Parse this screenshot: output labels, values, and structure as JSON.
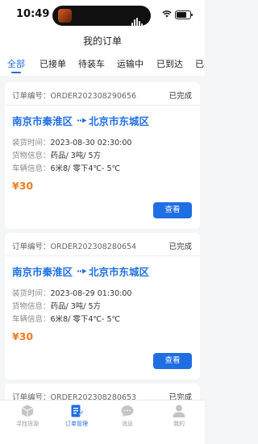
{
  "status_bar": {
    "time": "10:49"
  },
  "header": {
    "title": "我的订单"
  },
  "tabs": [
    {
      "label": "全部",
      "active": true
    },
    {
      "label": "已接单",
      "active": false
    },
    {
      "label": "待装车",
      "active": false
    },
    {
      "label": "运输中",
      "active": false
    },
    {
      "label": "已到达",
      "active": false
    },
    {
      "label": "已完成",
      "active": false
    }
  ],
  "orders": [
    {
      "order_label": "订单编号：",
      "order_no": "ORDER202308290656",
      "status": "已完成",
      "from_city": "南京市秦淮区",
      "to_city": "北京市东城区",
      "load_time_label": "装货时间：",
      "load_time": "2023-08-30 02:30:00",
      "cargo_label": "货物信息：",
      "cargo": "药品/ 3吨/ 5方",
      "vehicle_label": "车辆信息：",
      "vehicle": "6米8/ 零下4℃- 5℃",
      "price": "¥30",
      "action": "查看"
    },
    {
      "order_label": "订单编号：",
      "order_no": "ORDER202308280654",
      "status": "已完成",
      "from_city": "南京市秦淮区",
      "to_city": "北京市东城区",
      "load_time_label": "装货时间：",
      "load_time": "2023-08-29 01:30:00",
      "cargo_label": "货物信息：",
      "cargo": "药品/ 3吨/ 5方",
      "vehicle_label": "车辆信息：",
      "vehicle": "6米8/ 零下4℃- 5℃",
      "price": "¥30",
      "action": "查看"
    },
    {
      "order_label": "订单编号：",
      "order_no": "ORDER202308280653",
      "status": "已完成"
    }
  ],
  "bottom_nav": [
    {
      "label": "寻找货源",
      "icon": "cube-icon",
      "active": false
    },
    {
      "label": "订单管理",
      "icon": "order-doc-icon",
      "active": true
    },
    {
      "label": "消息",
      "icon": "chat-bubble-icon",
      "active": false
    },
    {
      "label": "我的",
      "icon": "user-icon",
      "active": false
    }
  ],
  "colors": {
    "accent": "#1f6fe3",
    "price": "#f07b1f",
    "background": "#f4f5f7"
  }
}
